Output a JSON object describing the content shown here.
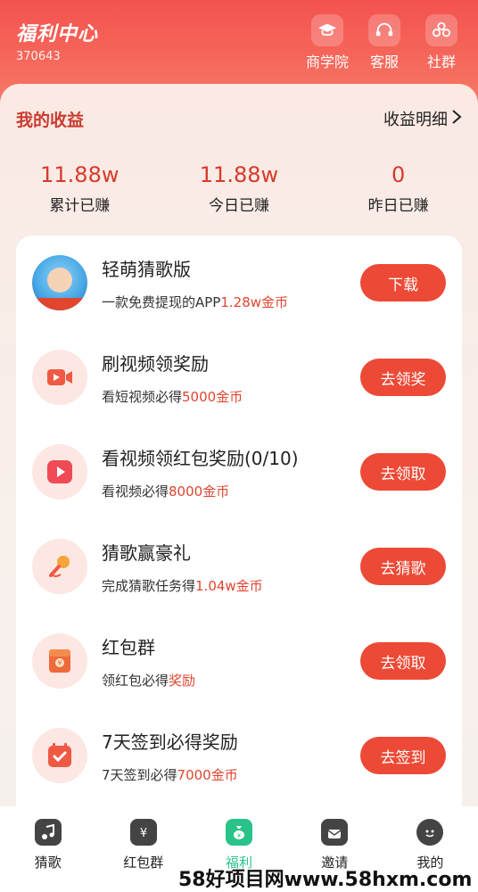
{
  "header": {
    "title": "福利中心",
    "id_number": "370643",
    "actions": [
      {
        "label": "商学院",
        "icon": "graduation-cap-icon"
      },
      {
        "label": "客服",
        "icon": "headset-icon"
      },
      {
        "label": "社群",
        "icon": "group-icon"
      }
    ]
  },
  "earnings": {
    "title": "我的收益",
    "detail_link": "收益明细",
    "stats": [
      {
        "value": "11.88w",
        "label": "累计已赚"
      },
      {
        "value": "11.88w",
        "label": "今日已赚"
      },
      {
        "value": "0",
        "label": "昨日已赚"
      }
    ]
  },
  "tasks": [
    {
      "name": "轻萌猜歌版",
      "desc_prefix": "一款免费提现的APP",
      "desc_highlight": "1.28w金币",
      "button": "下载",
      "icon": "app-avatar-icon"
    },
    {
      "name": "刷视频领奖励",
      "desc_prefix": "看短视频必得",
      "desc_highlight": "5000金币",
      "button": "去领奖",
      "icon": "video-camera-icon"
    },
    {
      "name": "看视频领红包奖励(0/10)",
      "desc_prefix": "看视频必得",
      "desc_highlight": "8000金币",
      "button": "去领取",
      "icon": "play-icon"
    },
    {
      "name": "猜歌赢豪礼",
      "desc_prefix": "完成猜歌任务得",
      "desc_highlight": "1.04w金币",
      "button": "去猜歌",
      "icon": "microphone-icon"
    },
    {
      "name": "红包群",
      "desc_prefix": "领红包必得",
      "desc_highlight": "奖励",
      "button": "去领取",
      "icon": "red-envelope-icon"
    },
    {
      "name": "7天签到必得奖励",
      "desc_prefix": "7天签到必得",
      "desc_highlight": "7000金币",
      "button": "去签到",
      "icon": "calendar-check-icon"
    }
  ],
  "tabbar": [
    {
      "label": "猜歌",
      "icon": "music-note-icon"
    },
    {
      "label": "红包群",
      "icon": "red-envelope-icon"
    },
    {
      "label": "福利",
      "icon": "money-bag-icon",
      "active": true
    },
    {
      "label": "邀请",
      "icon": "invite-icon"
    },
    {
      "label": "我的",
      "icon": "profile-icon"
    }
  ],
  "watermark": "58好项目网www.58hxm.com",
  "colors": {
    "accent": "#ec4a36",
    "active_tab": "#29c38a"
  }
}
